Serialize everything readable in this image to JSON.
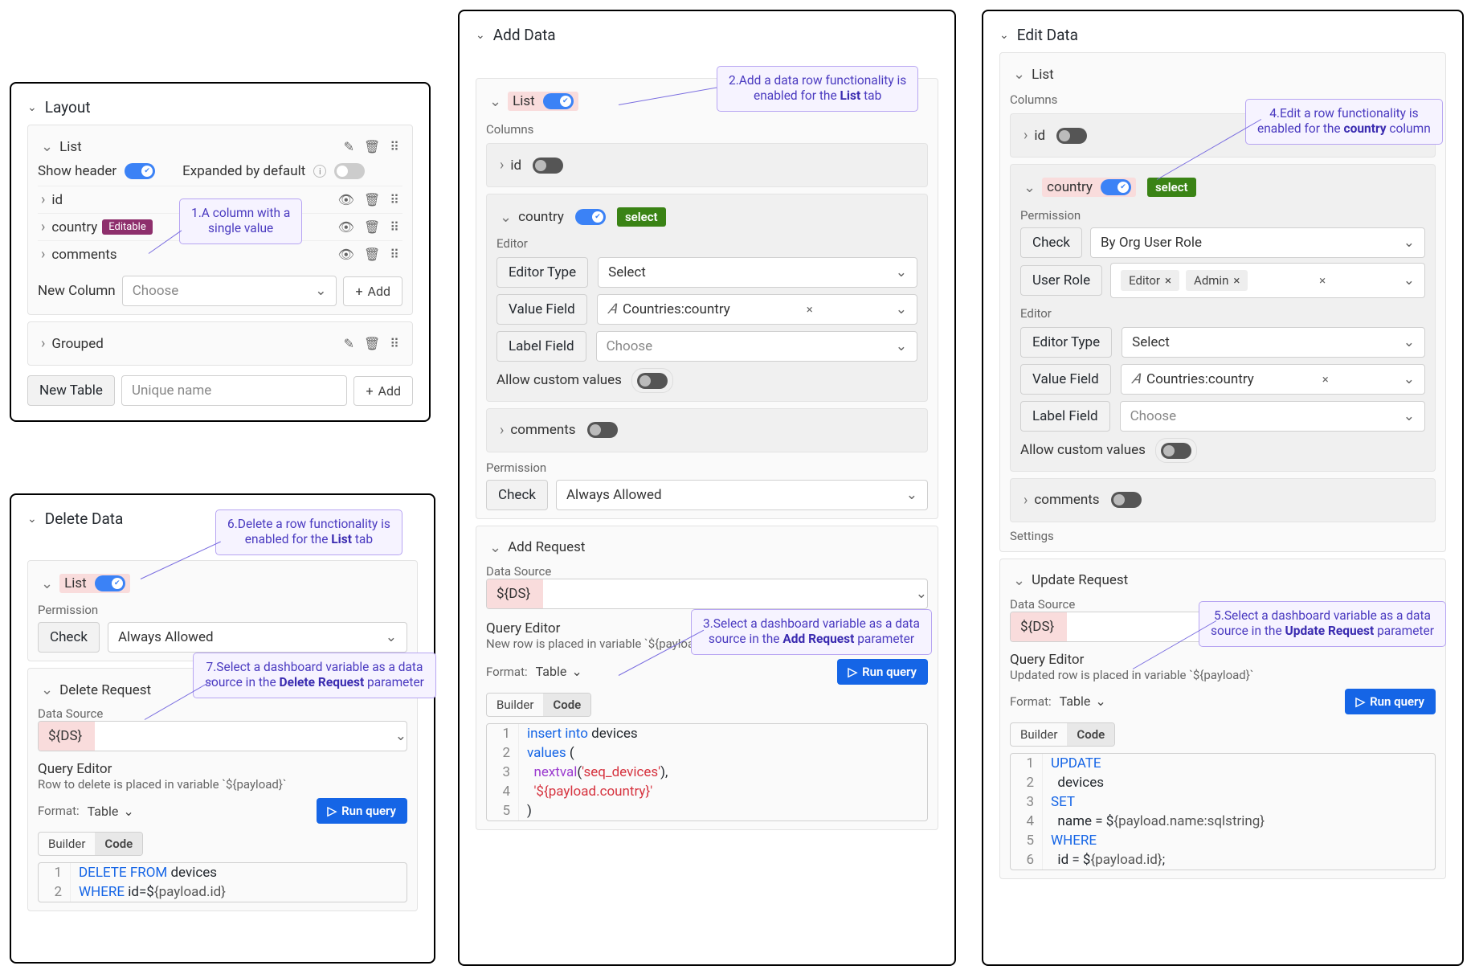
{
  "layout": {
    "title": "Layout",
    "list": {
      "label": "List",
      "showHeader": "Show header",
      "expanded": "Expanded by default",
      "cols": {
        "id": "id",
        "country": "country",
        "countryBadge": "Editable",
        "comments": "comments"
      },
      "newCol": "New Column",
      "choose": "Choose",
      "add": "Add"
    },
    "grouped": "Grouped",
    "newTable": "New Table",
    "unique": "Unique name"
  },
  "addData": {
    "title": "Add Data",
    "list": "List",
    "columns": "Columns",
    "id": "id",
    "country": "country",
    "select": "select",
    "editor": "Editor",
    "editorType": "Editor Type",
    "editorTypeVal": "Select",
    "valueField": "Value Field",
    "valueFieldVal": "Countries:country",
    "labelField": "Label Field",
    "labelFieldVal": "Choose",
    "allowCustom": "Allow custom values",
    "comments": "comments",
    "permission": "Permission",
    "check": "Check",
    "checkVal": "Always Allowed",
    "addReq": "Add Request",
    "dataSource": "Data Source",
    "ds": "${DS}",
    "queryEditor": "Query Editor",
    "queryHint": "New row is placed in variable `${payload}`",
    "format": "Format:",
    "formatVal": "Table",
    "run": "Run query",
    "builder": "Builder",
    "code": "Code",
    "sql": {
      "l1a": "insert",
      "l1b": "into",
      "l1c": " devices",
      "l2a": "values",
      "l2b": " (",
      "l3a": "nextval",
      "l3b": "(",
      "l3c": "'seq_devices'",
      "l3d": "),",
      "l4": "'${payload.country}'",
      "l5": ")"
    }
  },
  "editData": {
    "title": "Edit Data",
    "list": "List",
    "columns": "Columns",
    "id": "id",
    "country": "country",
    "select": "select",
    "permission": "Permission",
    "check": "Check",
    "checkVal": "By Org User Role",
    "userRole": "User Role",
    "roleEditor": "Editor",
    "roleAdmin": "Admin",
    "editor": "Editor",
    "editorType": "Editor Type",
    "editorTypeVal": "Select",
    "valueField": "Value Field",
    "valueFieldVal": "Countries:country",
    "labelField": "Label Field",
    "labelFieldVal": "Choose",
    "allowCustom": "Allow custom values",
    "comments": "comments",
    "settings": "Settings",
    "updateReq": "Update Request",
    "dataSource": "Data Source",
    "ds": "${DS}",
    "queryEditor": "Query Editor",
    "queryHint": "Updated row is placed in variable `${payload}`",
    "format": "Format:",
    "formatVal": "Table",
    "run": "Run query",
    "builder": "Builder",
    "code": "Code",
    "sql": {
      "l1": "UPDATE",
      "l2": "  devices",
      "l3": "SET",
      "l4a": "  name = $",
      "l4b": "{payload.name:sqlstring}",
      "l5": "WHERE",
      "l6a": "  id = $",
      "l6b": "{payload.id}",
      "l6c": ";"
    }
  },
  "deleteData": {
    "title": "Delete Data",
    "list": "List",
    "permission": "Permission",
    "check": "Check",
    "checkVal": "Always Allowed",
    "delReq": "Delete Request",
    "dataSource": "Data Source",
    "ds": "${DS}",
    "queryEditor": "Query Editor",
    "queryHint": "Row to delete is placed in variable `${payload}`",
    "format": "Format:",
    "formatVal": "Table",
    "run": "Run query",
    "builder": "Builder",
    "code": "Code",
    "sql": {
      "l1a": "DELETE",
      "l1b": "FROM",
      "l1c": " devices",
      "l2a": "WHERE",
      "l2b": " id=$",
      "l2c": "{payload.id}"
    }
  },
  "callouts": {
    "c1a": "1.A column with a",
    "c1b": "single value",
    "c2a": "2.Add a data row  functionality is",
    "c2b1": "enabled for the ",
    "c2b2": "List",
    "c2b3": " tab",
    "c3a": "3.Select a dashboard variable as a data",
    "c3b1": "source in the ",
    "c3b2": "Add Request",
    "c3b3": " parameter",
    "c4a": "4.Edit a row functionality is",
    "c4b1": "enabled for the ",
    "c4b2": "country",
    "c4b3": " column",
    "c5a": "5.Select a dashboard variable as a data",
    "c5b1": "source in the ",
    "c5b2": "Update Request",
    "c5b3": " parameter",
    "c6a": "6.Delete a row functionality is",
    "c6b1": "enabled for the ",
    "c6b2": "List",
    "c6b3": " tab",
    "c7a": "7.Select a dashboard variable as a data",
    "c7b1": "source in the ",
    "c7b2": "Delete Request",
    "c7b3": " parameter"
  }
}
